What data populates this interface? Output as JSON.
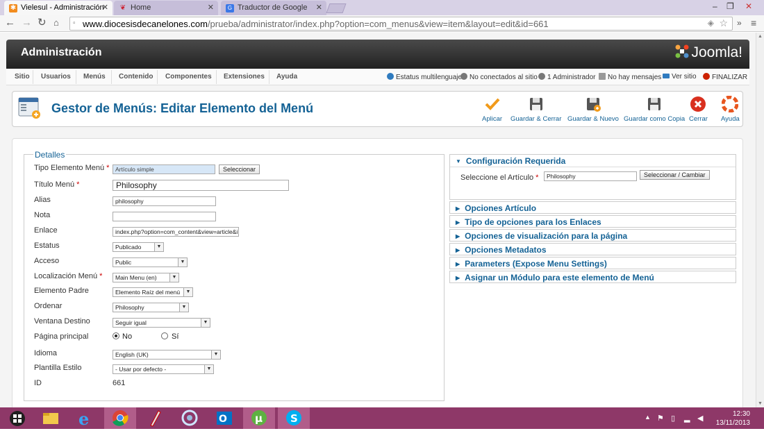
{
  "browser": {
    "tabs": [
      {
        "title": "Vielesul - Administración",
        "active": true
      },
      {
        "title": "Home",
        "active": false
      },
      {
        "title": "Traductor de Google",
        "active": false
      }
    ],
    "url_domain": "www.diocesisdecanelones.com",
    "url_path": "/prueba/administrator/index.php?option=com_menus&view=item&layout=edit&id=661"
  },
  "header": {
    "title": "Administración",
    "logo_text": "Joomla!"
  },
  "menu": {
    "items": [
      "Sitio",
      "Usuarios",
      "Menús",
      "Contenido",
      "Componentes",
      "Extensiones",
      "Ayuda"
    ],
    "status": [
      {
        "label": "Estatus multilenguaje",
        "icon": "globe-icon",
        "color": "#2f7bbf"
      },
      {
        "label": "No conectados al sitio",
        "icon": "users-icon",
        "color": "#666666"
      },
      {
        "label": "1 Administrador",
        "icon": "user-icon",
        "color": "#666666"
      },
      {
        "label": "No hay mensajes",
        "icon": "messages-icon",
        "color": "#666666"
      },
      {
        "label": "Ver sitio",
        "icon": "monitor-icon",
        "color": "#2f7bbf"
      },
      {
        "label": "FINALIZAR",
        "icon": "power-icon",
        "color": "#cc2200"
      }
    ]
  },
  "toolbar": {
    "page_title": "Gestor de Menús: Editar Elemento del Menú",
    "buttons": [
      {
        "label": "Aplicar",
        "icon": "check-icon"
      },
      {
        "label": "Guardar & Cerrar",
        "icon": "save-close-icon"
      },
      {
        "label": "Guardar & Nuevo",
        "icon": "save-new-icon"
      },
      {
        "label": "Guardar como Copia",
        "icon": "save-copy-icon"
      },
      {
        "label": "Cerrar",
        "icon": "close-icon"
      },
      {
        "label": "Ayuda",
        "icon": "help-icon"
      }
    ]
  },
  "details": {
    "legend": "Detalles",
    "fields": {
      "tipo": {
        "label": "Tipo Elemento Menú",
        "value": "Artículo simple",
        "button": "Seleccionar",
        "required": "*"
      },
      "titulo": {
        "label": "Título Menú",
        "value": "Philosophy",
        "required": "*"
      },
      "alias": {
        "label": "Alias",
        "value": "philosophy"
      },
      "nota": {
        "label": "Nota",
        "value": ""
      },
      "enlace": {
        "label": "Enlace",
        "value": "index.php?option=com_content&view=article&i"
      },
      "estatus": {
        "label": "Estatus",
        "value": "Publicado"
      },
      "acceso": {
        "label": "Acceso",
        "value": "Public"
      },
      "localizacion": {
        "label": "Localización Menú",
        "value": "Main Menu (en)",
        "required": "*"
      },
      "padre": {
        "label": "Elemento Padre",
        "value": "Elemento Raíz del menú"
      },
      "ordenar": {
        "label": "Ordenar",
        "value": "Philosophy"
      },
      "ventana": {
        "label": "Ventana Destino",
        "value": "Seguir igual"
      },
      "principal": {
        "label": "Página principal",
        "option_no": "No",
        "option_si": "Sí",
        "selected": "No"
      },
      "idioma": {
        "label": "Idioma",
        "value": "English (UK)"
      },
      "plantilla": {
        "label": "Plantilla Estilo",
        "value": "- Usar por defecto -"
      },
      "id": {
        "label": "ID",
        "value": "661"
      }
    }
  },
  "panels": {
    "required": {
      "title": "Configuración Requerida",
      "field_label": "Seleccione el Artículo",
      "required": "*",
      "field_value": "Philosophy",
      "button": "Seleccionar / Cambiar"
    },
    "collapsed": [
      "Opciones Artículo",
      "Tipo de opciones para los Enlaces",
      "Opciones de visualización para la página",
      "Opciones Metadatos",
      "Parameters (Expose Menu Settings)",
      "Asignar un Módulo para este elemento de Menú"
    ]
  },
  "taskbar": {
    "time": "12:30",
    "date": "13/11/2013"
  }
}
